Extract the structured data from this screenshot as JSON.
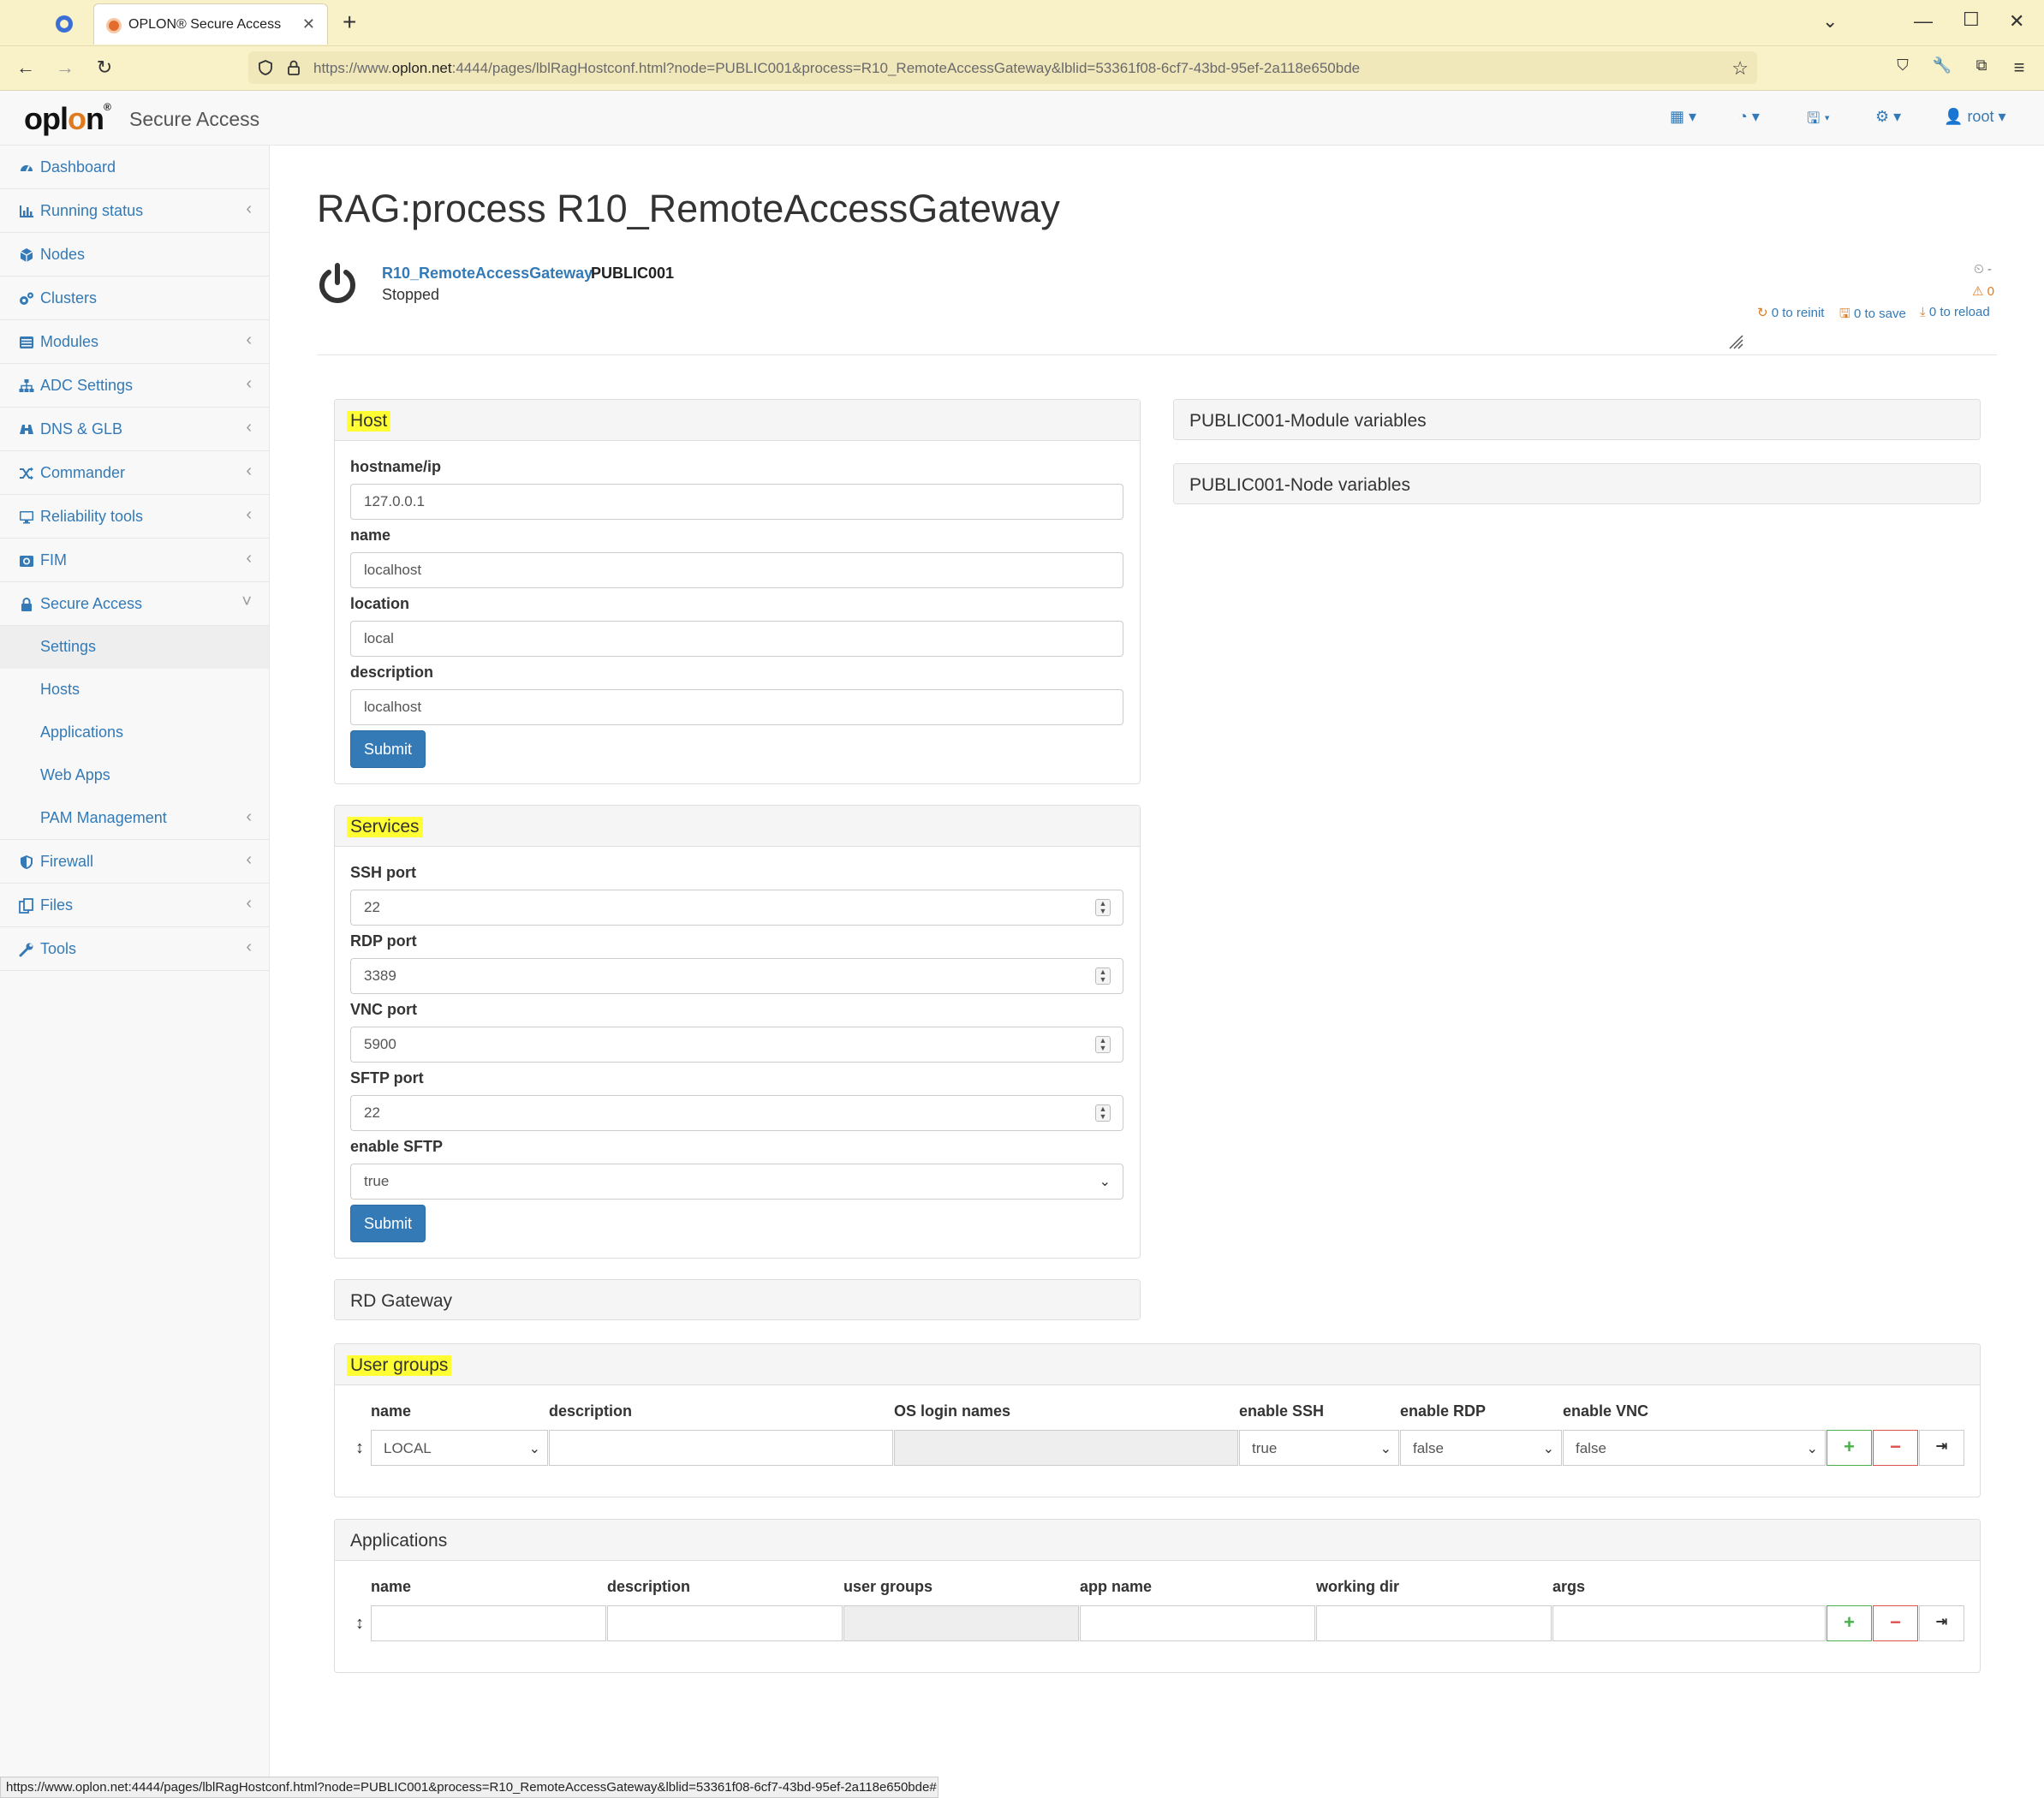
{
  "browser": {
    "tab_title": "OPLON® Secure Access",
    "url_prefix": "https://www.",
    "url_domain": "oplon.net",
    "url_rest": ":4444/pages/lblRagHostconf.html?node=PUBLIC001&process=R10_RemoteAccessGateway&lblid=53361f08-6cf7-43bd-95ef-2a118e650bde",
    "status_url": "https://www.oplon.net:4444/pages/lblRagHostconf.html?node=PUBLIC001&process=R10_RemoteAccessGateway&lblid=53361f08-6cf7-43bd-95ef-2a118e650bde#"
  },
  "app": {
    "logo": "oplon",
    "name": "Secure Access",
    "user": "root"
  },
  "sidebar": {
    "items": [
      {
        "label": "Dashboard",
        "icon": "dashboard-icon",
        "chevron": ""
      },
      {
        "label": "Running status",
        "icon": "bar-chart-icon",
        "chevron": "‹"
      },
      {
        "label": "Nodes",
        "icon": "cube-icon",
        "chevron": ""
      },
      {
        "label": "Clusters",
        "icon": "cogs-icon",
        "chevron": ""
      },
      {
        "label": "Modules",
        "icon": "list-icon",
        "chevron": "‹"
      },
      {
        "label": "ADC Settings",
        "icon": "sitemap-icon",
        "chevron": "‹"
      },
      {
        "label": "DNS & GLB",
        "icon": "binoculars-icon",
        "chevron": "‹"
      },
      {
        "label": "Commander",
        "icon": "random-icon",
        "chevron": "‹"
      },
      {
        "label": "Reliability tools",
        "icon": "desktop-icon",
        "chevron": "‹"
      },
      {
        "label": "FIM",
        "icon": "camera-icon",
        "chevron": "‹"
      },
      {
        "label": "Secure Access",
        "icon": "lock-icon",
        "chevron": "˅"
      }
    ],
    "sub_items": [
      {
        "label": "Settings",
        "chevron": ""
      },
      {
        "label": "Hosts",
        "chevron": ""
      },
      {
        "label": "Applications",
        "chevron": ""
      },
      {
        "label": "Web Apps",
        "chevron": ""
      },
      {
        "label": "PAM Management",
        "chevron": "‹"
      }
    ],
    "items_after": [
      {
        "label": "Firewall",
        "icon": "shield-icon",
        "chevron": "‹"
      },
      {
        "label": "Files",
        "icon": "files-icon",
        "chevron": "‹"
      },
      {
        "label": "Tools",
        "icon": "wrench-icon",
        "chevron": "‹"
      }
    ]
  },
  "page": {
    "title": "RAG:process R10_RemoteAccessGateway",
    "process_link": "R10_RemoteAccessGateway",
    "node": "PUBLIC001",
    "status": "Stopped",
    "uptime": "-",
    "warnings": "0",
    "reinit": "0 to reinit",
    "save": "0 to save",
    "reload": "0 to reload"
  },
  "host": {
    "title": "Host",
    "fields": [
      {
        "label": "hostname/ip",
        "value": "127.0.0.1"
      },
      {
        "label": "name",
        "value": "localhost"
      },
      {
        "label": "location",
        "value": "local"
      },
      {
        "label": "description",
        "value": "localhost"
      }
    ],
    "submit": "Submit"
  },
  "services": {
    "title": "Services",
    "fields": [
      {
        "label": "SSH port",
        "value": "22"
      },
      {
        "label": "RDP port",
        "value": "3389"
      },
      {
        "label": "VNC port",
        "value": "5900"
      },
      {
        "label": "SFTP port",
        "value": "22"
      }
    ],
    "sftp_label": "enable SFTP",
    "sftp_value": "true",
    "submit": "Submit"
  },
  "rd_gateway": {
    "title": "RD Gateway"
  },
  "module_vars": {
    "title": "PUBLIC001-Module variables"
  },
  "node_vars": {
    "title": "PUBLIC001-Node variables"
  },
  "user_groups": {
    "title": "User groups",
    "headers": [
      "name",
      "description",
      "OS login names",
      "enable SSH",
      "enable RDP",
      "enable VNC"
    ],
    "row": {
      "name": "LOCAL",
      "description": "",
      "os_login": "",
      "ssh": "true",
      "rdp": "false",
      "vnc": "false"
    }
  },
  "applications": {
    "title": "Applications",
    "headers": [
      "name",
      "description",
      "user groups",
      "app name",
      "working dir",
      "args"
    ]
  },
  "colors": {
    "accent": "#337ab7",
    "highlight": "#ffff33",
    "success": "#4cae4c",
    "danger": "#d9534f",
    "warning": "#e07a1f"
  }
}
